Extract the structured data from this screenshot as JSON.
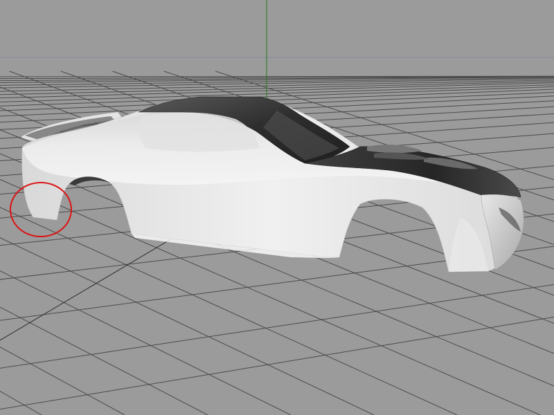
{
  "viewport": {
    "name": "3d-modeling-viewport",
    "background_color": "#9b9b9b",
    "grid_color": "#4a4a4a",
    "axis_y_color": "#1d7a1d"
  },
  "model": {
    "name": "car-body-shell",
    "body_color": "#e6e6e6",
    "roof_color": "#3a3a3a"
  },
  "annotation": {
    "name": "red-circle-markup",
    "color": "#dd1111"
  }
}
